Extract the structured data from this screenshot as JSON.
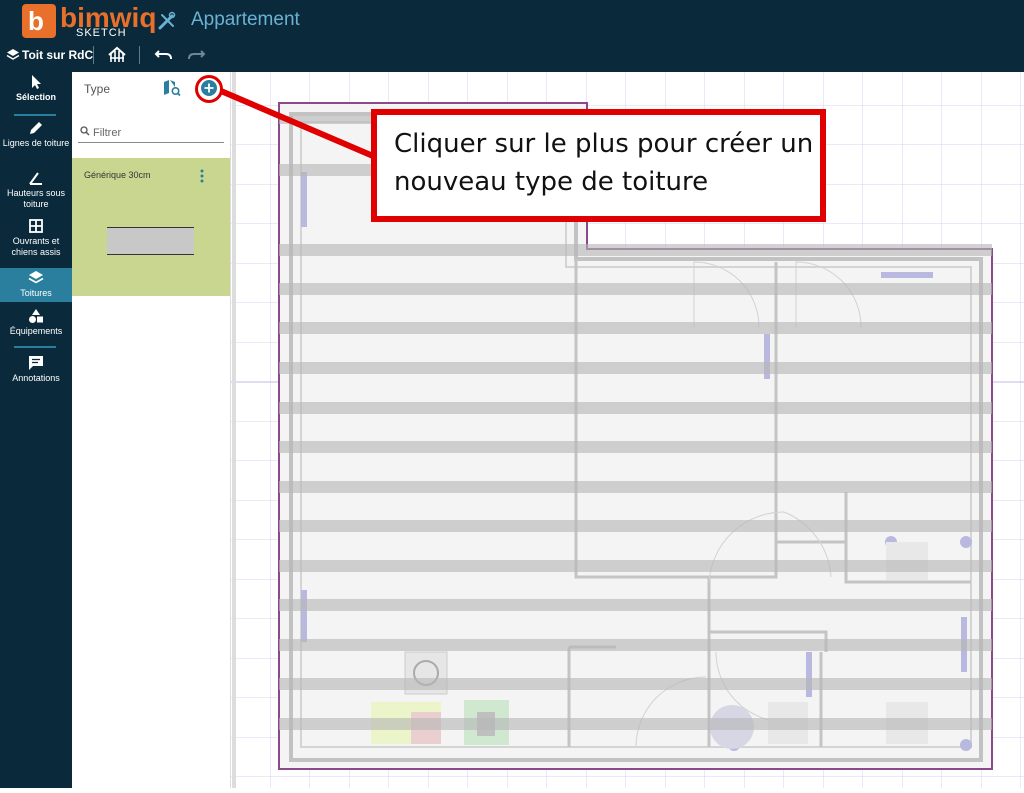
{
  "app": {
    "brand": "bimwiq",
    "brand_sub": "SKETCH",
    "project_name": "Appartement",
    "accent": "#e8702a",
    "dark_bg": "#0a2a3b",
    "link_color": "#6ab1d4"
  },
  "toolbar": {
    "level_label": "Toit sur RdC",
    "buttons": [
      "roof-structure-icon",
      "undo-icon",
      "redo-icon"
    ]
  },
  "sidebar": {
    "items": [
      {
        "label": "Sélection",
        "icon": "cursor-icon"
      },
      {
        "label": "Lignes de toiture",
        "icon": "pencil-icon"
      },
      {
        "label": "Hauteurs sous toiture",
        "icon": "angle-icon"
      },
      {
        "label": "Ouvrants et chiens assis",
        "icon": "window-icon"
      },
      {
        "label": "Toitures",
        "icon": "layers-icon",
        "active": true
      },
      {
        "label": "Équipements",
        "icon": "shapes-icon"
      },
      {
        "label": "Annotations",
        "icon": "comment-icon"
      }
    ]
  },
  "panel": {
    "title": "Type",
    "filter_placeholder": "Filtrer",
    "types": [
      {
        "name": "Générique 30cm",
        "selected_color": "#c9d68f"
      }
    ]
  },
  "callout": {
    "text": "Cliquer sur le plus pour créer un nouveau type de toiture",
    "color": "#e00000"
  }
}
